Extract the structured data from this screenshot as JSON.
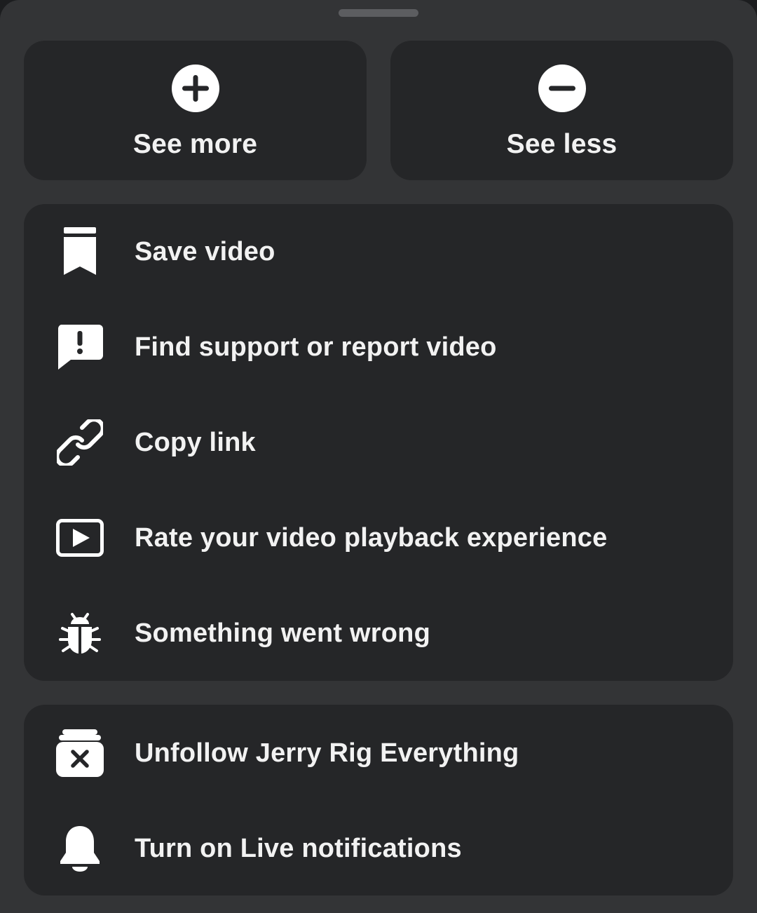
{
  "sheet": {
    "top_actions": [
      {
        "label": "See more",
        "icon": "plus-circle-icon"
      },
      {
        "label": "See less",
        "icon": "minus-circle-icon"
      }
    ],
    "main_menu": [
      {
        "label": "Save video",
        "icon": "bookmark-icon"
      },
      {
        "label": "Find support or report video",
        "icon": "report-icon"
      },
      {
        "label": "Copy link",
        "icon": "link-icon"
      },
      {
        "label": "Rate your video playback experience",
        "icon": "play-icon"
      },
      {
        "label": "Something went wrong",
        "icon": "bug-icon"
      }
    ],
    "follow_menu": [
      {
        "label": "Unfollow Jerry Rig Everything",
        "icon": "unfollow-icon"
      },
      {
        "label": "Turn on Live notifications",
        "icon": "bell-icon"
      }
    ]
  },
  "colors": {
    "sheet_background": "#333436",
    "card_background": "#252628",
    "text": "#f2f2f2",
    "icon": "#ffffff"
  }
}
